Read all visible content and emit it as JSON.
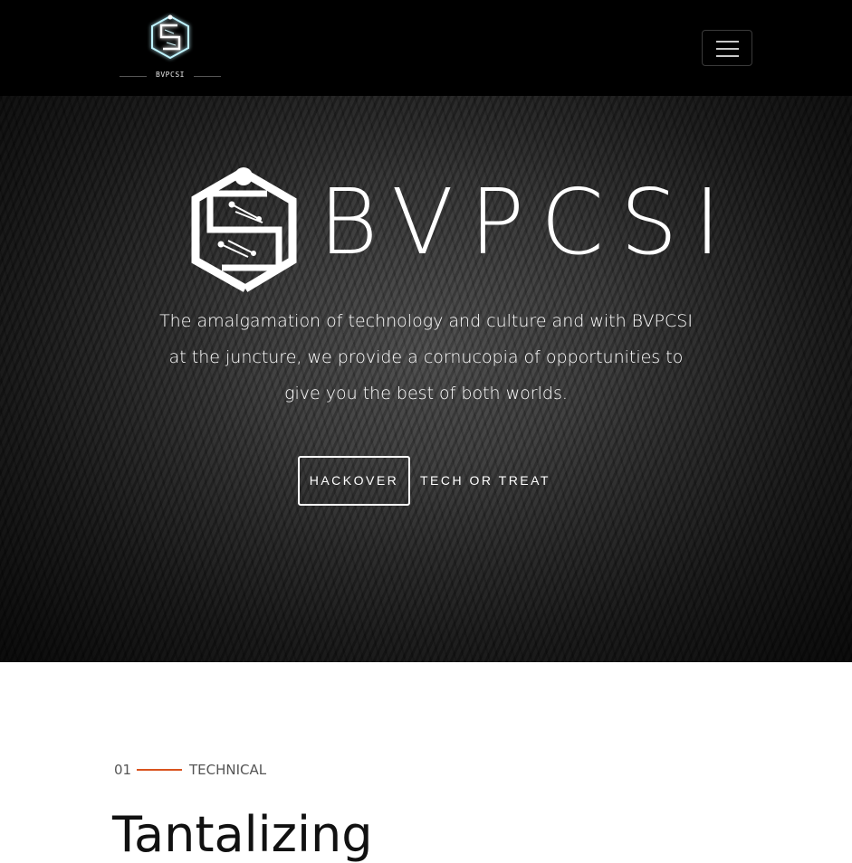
{
  "navbar": {
    "logo_text": "BVPCSI",
    "logo_icon": "bvpcsi-circuit-s-hexagon",
    "menu_icon": "hamburger-menu-icon",
    "background": "#000000"
  },
  "hero": {
    "brand": "BVPCSI",
    "tagline": "The amalgamation of technology and culture and with BVPCSI at the juncture, we provide a cornucopia of opportunities to give you the best of both worlds.",
    "primary_button": "HACKOVER",
    "secondary_button": "TECH OR TREAT"
  },
  "section": {
    "number": "01",
    "label": "TECHNICAL",
    "title": "Tantalizing",
    "accent_color": "#d9531e"
  }
}
